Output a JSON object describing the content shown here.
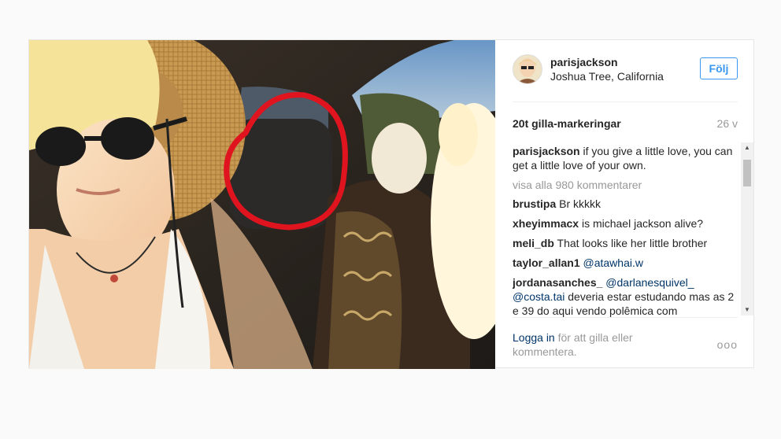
{
  "post": {
    "username": "parisjackson",
    "location": "Joshua Tree, California",
    "follow_label": "Följ",
    "likes": "20t gilla-markeringar",
    "time_ago": "26 v",
    "caption": {
      "user": "parisjackson",
      "text": " if you give a little love, you can get a little love of your own."
    },
    "view_all": "visa alla 980 kommentarer",
    "comments": [
      {
        "user": "brustipa",
        "pre": " Br kkkkk",
        "mention": "",
        "post": ""
      },
      {
        "user": "xheyimmacx",
        "pre": " is michael jackson alive?",
        "mention": "",
        "post": ""
      },
      {
        "user": "meli_db",
        "pre": " That looks like her little brother",
        "mention": "",
        "post": ""
      },
      {
        "user": "taylor_allan1",
        "pre": " ",
        "mention": "@atawhai.w",
        "post": ""
      },
      {
        "user": "jordanasanches_",
        "pre": " ",
        "mention": "@darlanesquivel_ @costa.tai",
        "post": " deveria estar estudando mas as 2 e 39 do aqui vendo polêmica com"
      }
    ],
    "footer": {
      "login_link": "Logga in",
      "login_rest": " för att gilla eller kommentera.",
      "more_label": "ooo"
    }
  },
  "colors": {
    "accent": "#3897f0",
    "link": "#003569",
    "muted": "#999999",
    "highlight_circle": "#e0141e"
  }
}
